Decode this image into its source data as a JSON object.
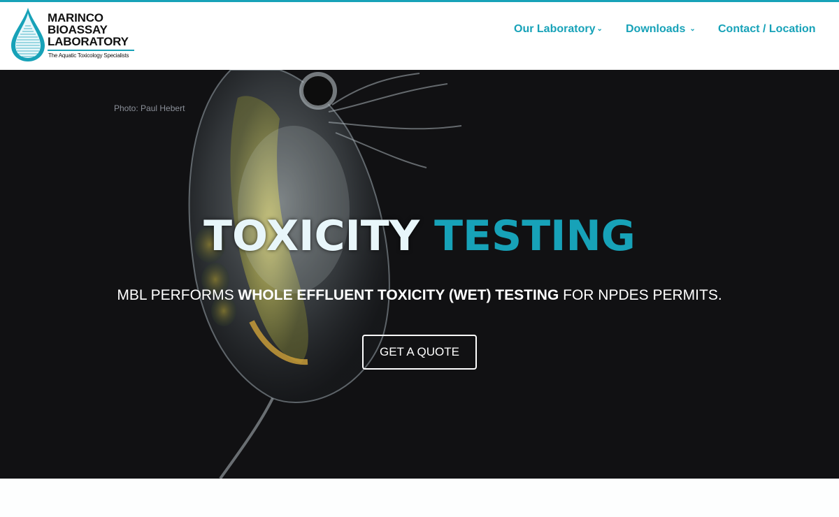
{
  "brand": {
    "logo_lines": [
      "MARINCO",
      "BIOASSAY",
      "LABORATORY"
    ],
    "tagline": "The Aquatic Toxicology Specialists",
    "accent_color": "#17a2b8"
  },
  "nav": {
    "items": [
      {
        "label": "Our Laboratory",
        "has_dropdown": true,
        "icon": "chevron-down-icon"
      },
      {
        "label": "Downloads",
        "has_dropdown": true,
        "icon": "chevron-down-icon"
      },
      {
        "label": "Contact / Location",
        "has_dropdown": false
      }
    ]
  },
  "hero": {
    "photo_credit": "Photo: Paul Hebert",
    "title_part1": "TOXICITY",
    "title_part2": "TESTING",
    "subtitle_prefix": "MBL PERFORMS ",
    "subtitle_bold": "WHOLE EFFLUENT TOXICITY (WET) TESTING",
    "subtitle_suffix": " FOR NPDES PERMITS.",
    "cta_label": "GET A QUOTE"
  }
}
